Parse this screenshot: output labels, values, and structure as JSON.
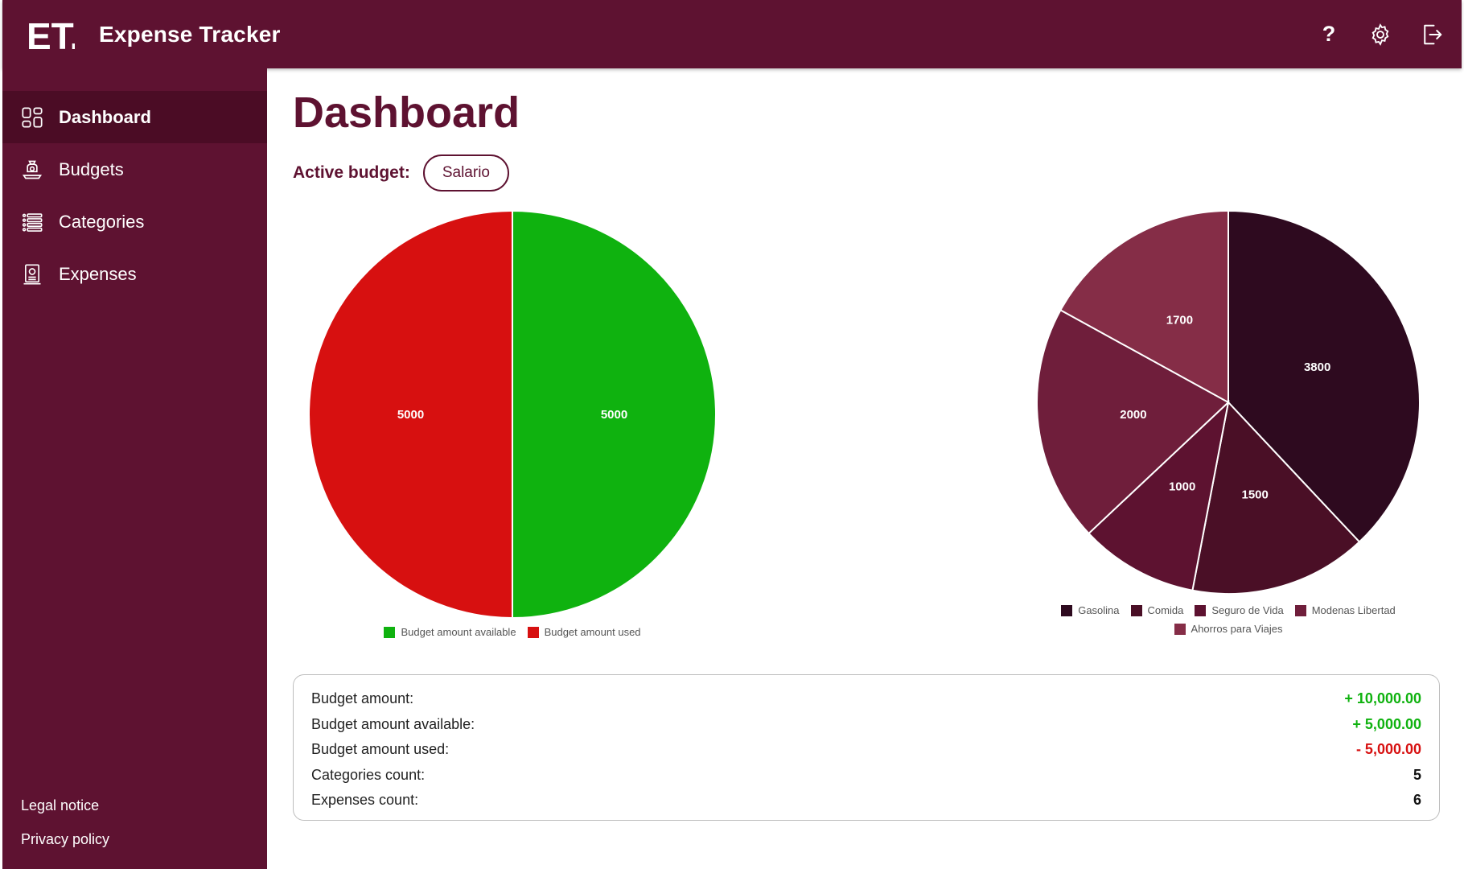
{
  "app": {
    "title": "Expense Tracker",
    "logo_text": "ET."
  },
  "topbar": {
    "help_glyph": "?",
    "icons": [
      "help-icon",
      "gear-icon",
      "logout-icon"
    ]
  },
  "sidebar": {
    "items": [
      {
        "label": "Dashboard",
        "icon": "dashboard-icon",
        "active": true
      },
      {
        "label": "Budgets",
        "icon": "budget-icon",
        "active": false
      },
      {
        "label": "Categories",
        "icon": "list-icon",
        "active": false
      },
      {
        "label": "Expenses",
        "icon": "receipt-icon",
        "active": false
      }
    ],
    "footer": [
      {
        "label": "Legal notice"
      },
      {
        "label": "Privacy policy"
      }
    ]
  },
  "page": {
    "title": "Dashboard",
    "active_budget_label": "Active budget:",
    "active_budget_value": "Salario"
  },
  "chart_data": [
    {
      "type": "pie",
      "slices": [
        {
          "label": "Budget amount available",
          "value": 5000,
          "color": "#0fb20f"
        },
        {
          "label": "Budget amount used",
          "value": 5000,
          "color": "#d71010"
        }
      ],
      "legend_position": "bottom"
    },
    {
      "type": "pie",
      "slices": [
        {
          "label": "Gasolina",
          "value": 3800,
          "color": "#2e0a1f"
        },
        {
          "label": "Comida",
          "value": 1500,
          "color": "#4a0f26"
        },
        {
          "label": "Seguro de Vida",
          "value": 1000,
          "color": "#5d1230"
        },
        {
          "label": "Modenas Libertad",
          "value": 2000,
          "color": "#6f1e3b"
        },
        {
          "label": "Ahorros para Viajes",
          "value": 1700,
          "color": "#852d47"
        }
      ],
      "legend_position": "bottom"
    }
  ],
  "summary": {
    "rows": [
      {
        "label": "Budget amount:",
        "value": "+ 10,000.00",
        "color": "#0fb20f"
      },
      {
        "label": "Budget amount available:",
        "value": "+ 5,000.00",
        "color": "#0fb20f"
      },
      {
        "label": "Budget amount used:",
        "value": "- 5,000.00",
        "color": "#d71010"
      },
      {
        "label": "Categories count:",
        "value": "5",
        "color": "#111111"
      },
      {
        "label": "Expenses count:",
        "value": "6",
        "color": "#111111"
      }
    ]
  }
}
